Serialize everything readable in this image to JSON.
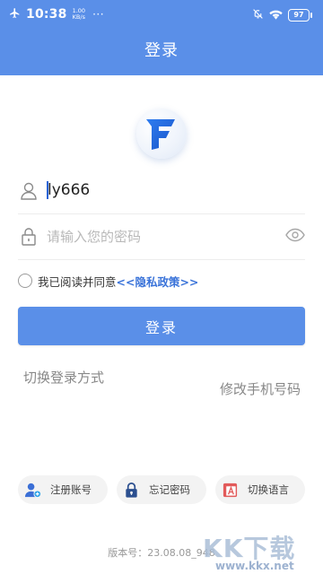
{
  "status_bar": {
    "time": "10:38",
    "net_speed_value": "1.00",
    "net_speed_unit": "KB/s",
    "dots": "···",
    "battery": "97"
  },
  "header": {
    "title": "登录"
  },
  "form": {
    "username_value": "ly666",
    "password_placeholder": "请输入您的密码"
  },
  "agreement": {
    "text": "我已阅读并同意",
    "link": "<<隐私政策>>"
  },
  "login_button": "登录",
  "switch_login_method": "切换登录方式",
  "change_phone": "修改手机号码",
  "bottom_actions": [
    {
      "label": "注册账号",
      "icon": "add-user-icon"
    },
    {
      "label": "忘记密码",
      "icon": "lock-icon"
    },
    {
      "label": "切换语言",
      "icon": "language-icon"
    }
  ],
  "version": "版本号：23.08.08_948",
  "watermark": {
    "logo": "KK下载",
    "url": "www.kkx.net"
  },
  "colors": {
    "primary": "#5a8fe8",
    "link": "#3a73d9"
  }
}
